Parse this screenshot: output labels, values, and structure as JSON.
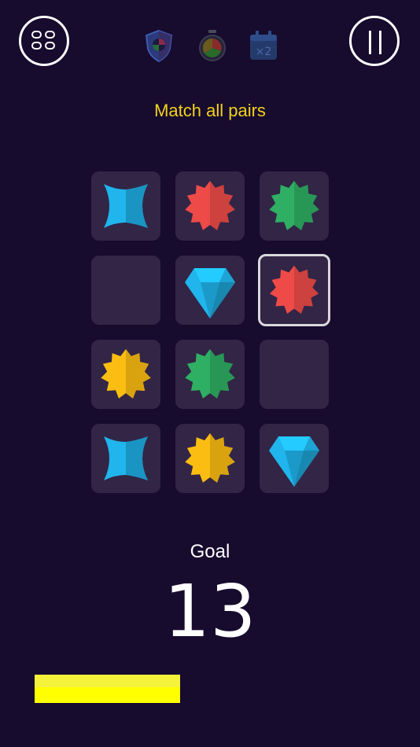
{
  "header": {
    "menu_icon": "grid-menu-icon",
    "pause_icon": "pause-icon",
    "powerups": [
      {
        "name": "shield-powerup",
        "icon": "shield-icon"
      },
      {
        "name": "timer-powerup",
        "icon": "stopwatch-icon"
      },
      {
        "name": "double-powerup",
        "icon": "calendar-x2-icon",
        "label": "×2"
      }
    ]
  },
  "title": "Match all pairs",
  "board": {
    "rows": 4,
    "cols": 3,
    "tiles": [
      {
        "row": 0,
        "col": 0,
        "symbol": "star4",
        "color": "#20b5ec"
      },
      {
        "row": 0,
        "col": 1,
        "symbol": "burst",
        "color": "#ee4b48"
      },
      {
        "row": 0,
        "col": 2,
        "symbol": "burst",
        "color": "#2faf63"
      },
      {
        "row": 1,
        "col": 0,
        "symbol": "empty"
      },
      {
        "row": 1,
        "col": 1,
        "symbol": "diamond",
        "color": "#20b5ec"
      },
      {
        "row": 1,
        "col": 2,
        "symbol": "burst",
        "color": "#ee4b48",
        "selected": true
      },
      {
        "row": 2,
        "col": 0,
        "symbol": "burst",
        "color": "#fbbd12"
      },
      {
        "row": 2,
        "col": 1,
        "symbol": "burst",
        "color": "#2faf63"
      },
      {
        "row": 2,
        "col": 2,
        "symbol": "empty"
      },
      {
        "row": 3,
        "col": 0,
        "symbol": "star4",
        "color": "#20b5ec"
      },
      {
        "row": 3,
        "col": 1,
        "symbol": "burst",
        "color": "#fbbd12"
      },
      {
        "row": 3,
        "col": 2,
        "symbol": "diamond",
        "color": "#20b5ec"
      }
    ]
  },
  "goal": {
    "label": "Goal",
    "value": "13"
  },
  "progress": {
    "fraction": 0.415,
    "color": "#ffff00"
  }
}
